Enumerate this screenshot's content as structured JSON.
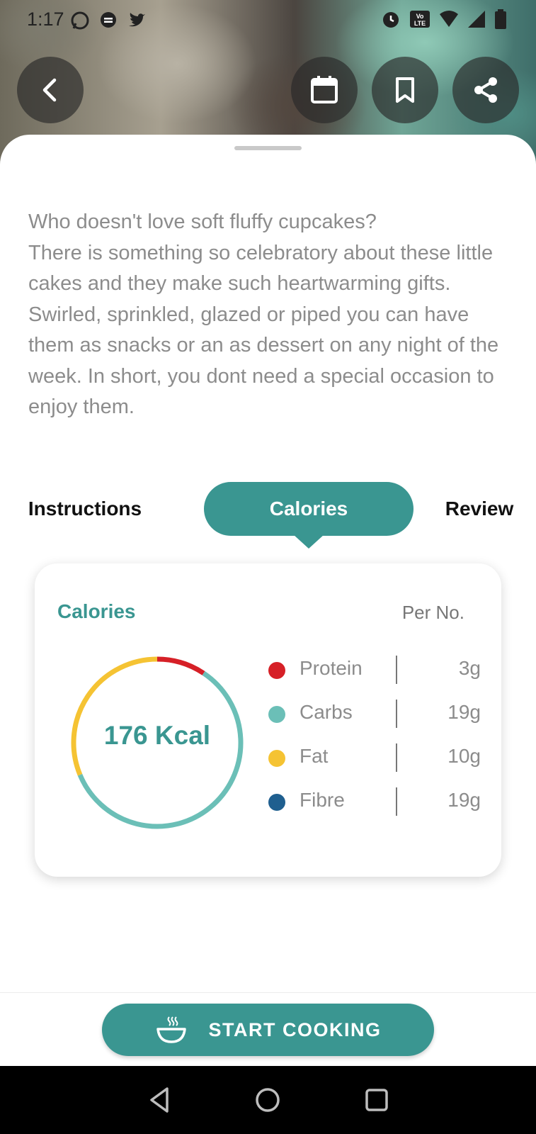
{
  "status_bar": {
    "time": "1:17",
    "left_icons": [
      "whatsapp-icon",
      "message-icon",
      "twitter-icon"
    ],
    "right_icons": [
      "alarm-icon",
      "volte-icon",
      "wifi-icon",
      "signal-icon",
      "battery-icon"
    ],
    "volte_text": "Vo LTE"
  },
  "header": {
    "buttons": [
      "back-icon",
      "calendar-icon",
      "bookmark-icon",
      "share-icon"
    ]
  },
  "description": "Who doesn't love soft fluffy cupcakes?\nThere is something so celebratory about these little cakes and they make such heartwarming gifts.\nSwirled, sprinkled, glazed or piped you can have them as snacks or an as dessert on any night of the week. In short, you dont need a special occasion to enjoy them.",
  "tabs": [
    {
      "label": "Instructions",
      "active": false
    },
    {
      "label": "Calories",
      "active": true
    },
    {
      "label": "Review",
      "active": false
    }
  ],
  "calories_card": {
    "title": "Calories",
    "per": "Per No.",
    "total": "176 Kcal",
    "nutrients": [
      {
        "name": "Protein",
        "value": "3g",
        "color": "#d62027"
      },
      {
        "name": "Carbs",
        "value": "19g",
        "color": "#6bbfb7"
      },
      {
        "name": "Fat",
        "value": "10g",
        "color": "#f5c333"
      },
      {
        "name": "Fibre",
        "value": "19g",
        "color": "#1f5f8f"
      }
    ]
  },
  "chart_data": {
    "type": "pie",
    "categories": [
      "Protein",
      "Carbs",
      "Fat",
      "Fibre"
    ],
    "values": [
      3,
      19,
      10,
      19
    ],
    "colors": [
      "#d62027",
      "#6bbfb7",
      "#f5c333",
      "#1f5f8f"
    ]
  },
  "cook_button": {
    "label": "START COOKING",
    "icon": "steaming-bowl-icon"
  },
  "nav": [
    "back-triangle-icon",
    "home-circle-icon",
    "recents-square-icon"
  ],
  "colors": {
    "accent": "#3a9691",
    "text_muted": "#8c8c8c"
  }
}
